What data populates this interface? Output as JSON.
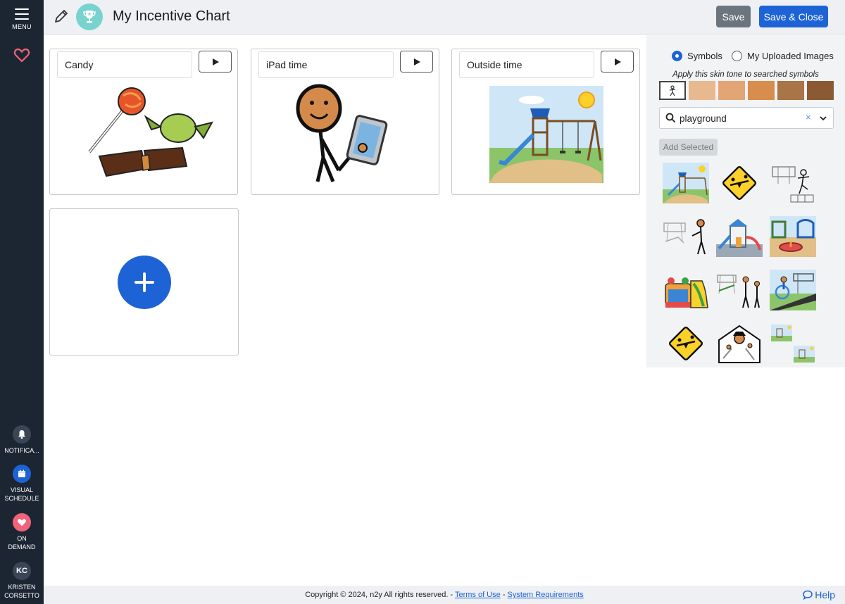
{
  "sidebar": {
    "menu_label": "MENU",
    "items": [
      {
        "label": "NOTIFICA...",
        "icon": "bell-icon"
      },
      {
        "label": "VISUAL SCHEDULE",
        "icon": "calendar-icon"
      },
      {
        "label": "ON DEMAND",
        "icon": "heart-icon"
      },
      {
        "label": "KRISTEN CORSETTO",
        "initials": "KC"
      }
    ]
  },
  "header": {
    "title": "My Incentive Chart",
    "save_label": "Save",
    "save_close_label": "Save & Close"
  },
  "cards": [
    {
      "label": "Candy",
      "art": "candy"
    },
    {
      "label": "iPad time",
      "art": "ipad-person"
    },
    {
      "label": "Outside time",
      "art": "playground"
    }
  ],
  "panel": {
    "radio_symbols": "Symbols",
    "radio_uploads": "My Uploaded Images",
    "skin_tone_label": "Apply this skin tone to searched symbols",
    "skin_tones": [
      "#e8b88f",
      "#e3a574",
      "#d98d4c",
      "#a97446",
      "#8b5a32"
    ],
    "search_value": "playground",
    "clear_symbol": "×",
    "add_selected_label": "Add Selected"
  },
  "footer": {
    "copyright": "Copyright © 2024, n2y All rights reserved. -",
    "terms": "Terms of Use",
    "separator": "-",
    "requirements": "System Requirements",
    "help": "Help"
  },
  "colors": {
    "accent": "#1e63d6",
    "sidebar_bg": "#1c2633",
    "favorite": "#f0637a"
  }
}
